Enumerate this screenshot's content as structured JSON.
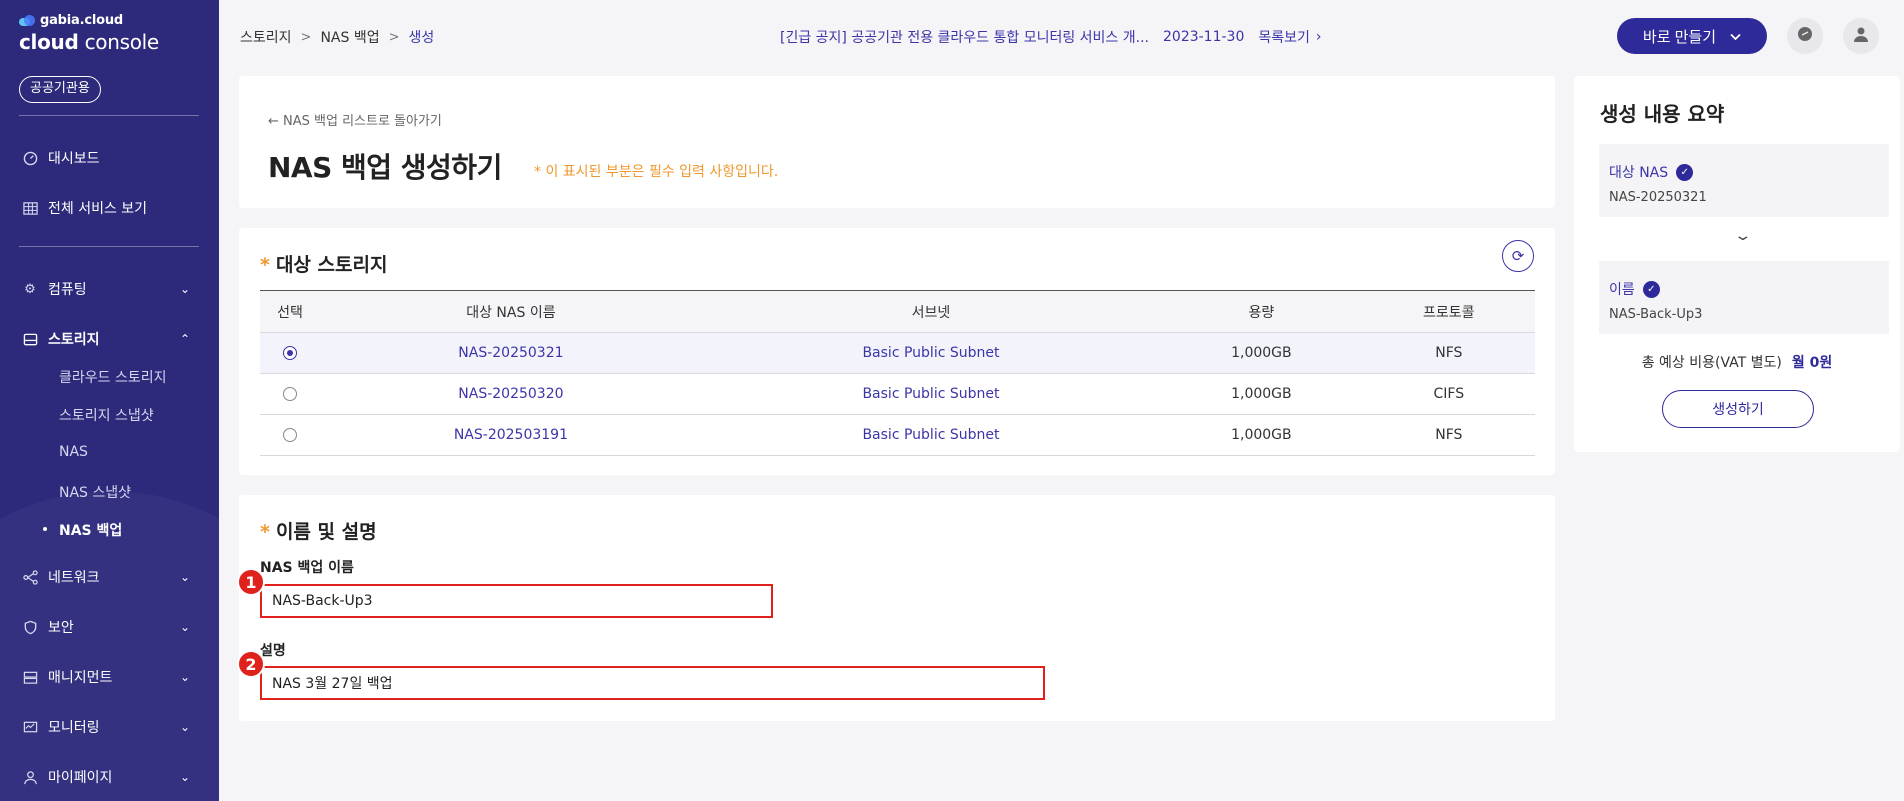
{
  "brand": {
    "small": "gabia.cloud",
    "big_prefix": "cloud",
    "big_suffix": "console",
    "badge": "공공기관용"
  },
  "sidebar": {
    "items": [
      {
        "label": "대시보드",
        "icon": "dashboard-icon"
      },
      {
        "label": "전체 서비스 보기",
        "icon": "grid-icon"
      },
      {
        "label": "컴퓨팅",
        "icon": "gear-icon"
      },
      {
        "label": "스토리지",
        "icon": "storage-icon"
      },
      {
        "label": "네트워크",
        "icon": "network-icon"
      },
      {
        "label": "보안",
        "icon": "shield-icon"
      },
      {
        "label": "매니지먼트",
        "icon": "server-icon"
      },
      {
        "label": "모니터링",
        "icon": "monitor-icon"
      },
      {
        "label": "마이페이지",
        "icon": "user-icon"
      }
    ],
    "storage_sub": [
      "클라우드 스토리지",
      "스토리지 스냅샷",
      "NAS",
      "NAS 스냅샷",
      "NAS 백업"
    ]
  },
  "breadcrumb": [
    "스토리지",
    "NAS 백업",
    "생성"
  ],
  "notice": {
    "text": "[긴급 공지] 공공기관 전용 클라우드 통합 모니터링 서비스 개...",
    "date": "2023-11-30",
    "more": "목록보기"
  },
  "header": {
    "quick_create": "바로 만들기"
  },
  "page": {
    "back_link": "← NAS 백업 리스트로 돌아가기",
    "title": "NAS 백업 생성하기",
    "required_note": "* 이 표시된 부분은 필수 입력 사항입니다."
  },
  "storage_section": {
    "title": "대상 스토리지",
    "columns": [
      "선택",
      "대상 NAS 이름",
      "서브넷",
      "용량",
      "프로토콜"
    ],
    "rows": [
      {
        "name": "NAS-20250321",
        "subnet": "Basic Public Subnet",
        "size": "1,000GB",
        "protocol": "NFS",
        "selected": true
      },
      {
        "name": "NAS-20250320",
        "subnet": "Basic Public Subnet",
        "size": "1,000GB",
        "protocol": "CIFS",
        "selected": false
      },
      {
        "name": "NAS-202503191",
        "subnet": "Basic Public Subnet",
        "size": "1,000GB",
        "protocol": "NFS",
        "selected": false
      }
    ]
  },
  "name_section": {
    "title": "이름 및 설명",
    "name_label": "NAS 백업 이름",
    "name_value": "NAS-Back-Up3",
    "desc_label": "설명",
    "desc_value": "NAS 3월 27일 백업",
    "marker1": "1",
    "marker2": "2"
  },
  "summary": {
    "title": "생성 내용 요약",
    "target_label": "대상 NAS",
    "target_value": "NAS-20250321",
    "name_label": "이름",
    "name_value": "NAS-Back-Up3",
    "cost_label": "총 예상 비용(VAT 별도)",
    "cost_value": "월 0원",
    "create_button": "생성하기"
  },
  "colors": {
    "sidebar": "#2d2a7c",
    "accent": "#2e2a9a",
    "required": "#f0982f",
    "highlight": "#e0221d"
  }
}
